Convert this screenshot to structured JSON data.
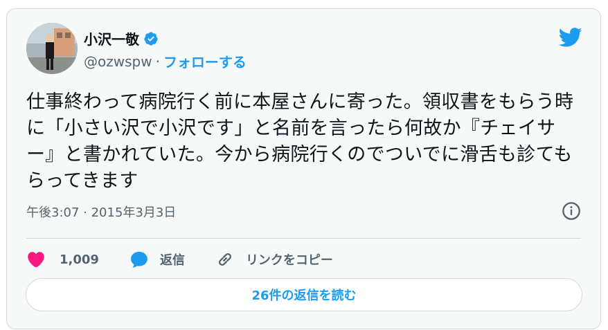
{
  "user": {
    "display_name": "小沢一敬",
    "handle": "@ozwspw",
    "separator": "·",
    "follow_label": "フォローする",
    "verified": true
  },
  "tweet": {
    "text": "仕事終わって病院行く前に本屋さんに寄った。領収書をもらう時に「小さい沢で小沢です」と名前を言ったら何故か『チェイサー』と書かれていた。今から病院行くのでついでに滑舌も診てもらってきます",
    "timestamp": "午後3:07 · 2015年3月3日"
  },
  "actions": {
    "likes": "1,009",
    "reply_label": "返信",
    "copy_link_label": "リンクをコピー"
  },
  "read_replies_label": "26件の返信を読む",
  "colors": {
    "accent": "#1d9bf0",
    "like": "#f91880",
    "secondary_text": "#536471",
    "border": "#cfd9de"
  },
  "icons": [
    "verified-badge-icon",
    "twitter-bird-icon",
    "info-icon",
    "heart-icon",
    "reply-bubble-icon",
    "link-icon"
  ]
}
